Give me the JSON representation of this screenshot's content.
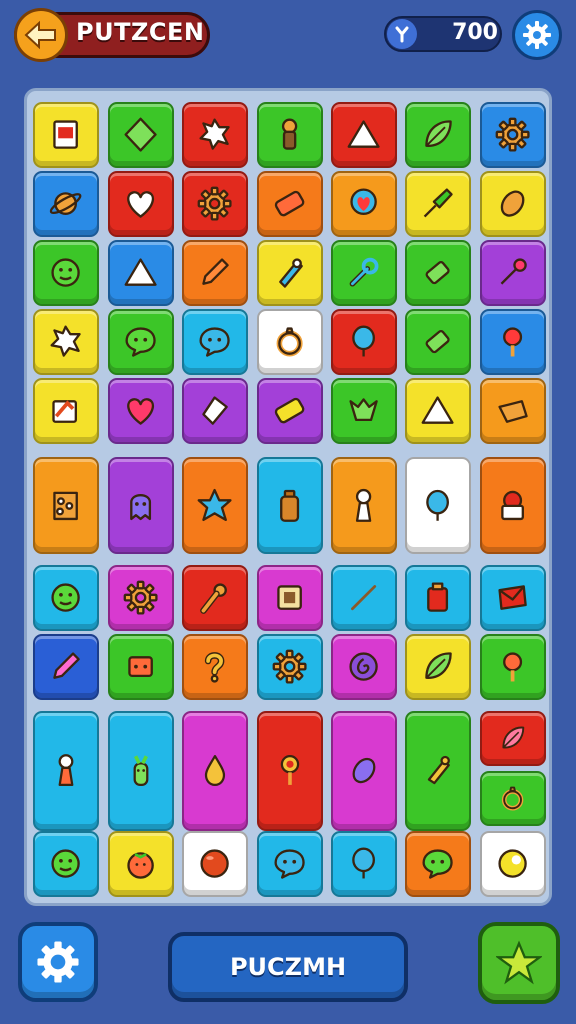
{
  "header": {
    "title": "PUTZCEN",
    "back_icon": "arrow-left-icon",
    "score": "700",
    "score_icon": "tool-icon",
    "settings_icon": "gear-icon"
  },
  "colors": {
    "background": "#3a5ba8",
    "board": "#b6cae4",
    "accent_orange": "#f5a11c",
    "title_pill": "#8f1f1f"
  },
  "board": {
    "rows": [
      [
        {
          "color": "#f4e12a",
          "icon": "card-icon"
        },
        {
          "color": "#3cc628",
          "icon": "diamond-icon"
        },
        {
          "color": "#e22a1e",
          "icon": "star-blob-icon"
        },
        {
          "color": "#3cc628",
          "icon": "pepper-mill-icon"
        },
        {
          "color": "#e22a1e",
          "icon": "triangle-icon"
        },
        {
          "color": "#3cc628",
          "icon": "leaf-icon"
        },
        {
          "color": "#2a8be6",
          "icon": "gear-icon"
        }
      ],
      [
        {
          "color": "#2a8be6",
          "icon": "planet-icon"
        },
        {
          "color": "#e22a1e",
          "icon": "heart-icon"
        },
        {
          "color": "#e22a1e",
          "icon": "gear-icon"
        },
        {
          "color": "#f57a1a",
          "icon": "tag-icon"
        },
        {
          "color": "#f59a1c",
          "icon": "heart-pin-icon"
        },
        {
          "color": "#f4e12a",
          "icon": "brush-icon"
        },
        {
          "color": "#f4e12a",
          "icon": "seed-icon"
        }
      ],
      [
        {
          "color": "#3cc628",
          "icon": "face-icon"
        },
        {
          "color": "#2a8be6",
          "icon": "triangle-icon"
        },
        {
          "color": "#f57a1a",
          "icon": "pencil-icon"
        },
        {
          "color": "#f4e12a",
          "icon": "tool-icon"
        },
        {
          "color": "#3cc628",
          "icon": "wrench-icon"
        },
        {
          "color": "#3cc628",
          "icon": "bar-icon"
        },
        {
          "color": "#a340d8",
          "icon": "wand-icon"
        }
      ],
      [
        {
          "color": "#f4e12a",
          "icon": "star-blob-icon"
        },
        {
          "color": "#3cc628",
          "icon": "bubble-icon"
        },
        {
          "color": "#22b8e8",
          "icon": "bubble-icon"
        },
        {
          "color": "#ffffff",
          "icon": "ring-icon"
        },
        {
          "color": "#e22a1e",
          "icon": "balloon-icon"
        },
        {
          "color": "#3cc628",
          "icon": "bar-icon"
        },
        {
          "color": "#2a8be6",
          "icon": "pin-icon"
        }
      ],
      [
        {
          "color": "#f4e12a",
          "icon": "box-icon"
        },
        {
          "color": "#a340d8",
          "icon": "heart-icon"
        },
        {
          "color": "#a340d8",
          "icon": "gem-icon"
        },
        {
          "color": "#a340d8",
          "icon": "tag-icon"
        },
        {
          "color": "#3cc628",
          "icon": "shield-icon"
        },
        {
          "color": "#f4e12a",
          "icon": "triangle-icon"
        },
        {
          "color": "#f59a1c",
          "icon": "bag-icon"
        }
      ],
      [
        {
          "color": "#f59a1c",
          "icon": "palette-icon"
        },
        {
          "color": "#a340d8",
          "icon": "ghost-icon"
        },
        {
          "color": "#f57a1a",
          "icon": "star-icon"
        },
        {
          "color": "#22b8e8",
          "icon": "bottle-icon"
        },
        {
          "color": "#f59a1c",
          "icon": "figure-icon"
        },
        {
          "color": "#ffffff",
          "icon": "balloon-icon"
        },
        {
          "color": "#f57a1a",
          "icon": "cup-icon"
        }
      ],
      [
        {
          "color": "#22b8e8",
          "icon": "face-icon"
        },
        {
          "color": "#d83ad0",
          "icon": "gear-icon"
        },
        {
          "color": "#e22a1e",
          "icon": "mic-icon"
        },
        {
          "color": "#d83ad0",
          "icon": "chip-icon"
        },
        {
          "color": "#22b8e8",
          "icon": "line-icon"
        },
        {
          "color": "#22b8e8",
          "icon": "jar-icon"
        },
        {
          "color": "#22b8e8",
          "icon": "envelope-icon"
        }
      ],
      [
        {
          "color": "#2a5fd6",
          "icon": "pencil-icon"
        },
        {
          "color": "#3cc628",
          "icon": "die-icon"
        },
        {
          "color": "#f57a1a",
          "icon": "question-icon"
        },
        {
          "color": "#22b8e8",
          "icon": "gear-icon"
        },
        {
          "color": "#d83ad0",
          "icon": "swirl-icon"
        },
        {
          "color": "#f4e12a",
          "icon": "leaf-icon"
        },
        {
          "color": "#3cc628",
          "icon": "pin-icon"
        }
      ],
      [
        {
          "color": "#22b8e8",
          "icon": "figure-icon",
          "tall": true
        },
        {
          "color": "#22b8e8",
          "icon": "cactus-icon",
          "tall": true
        },
        {
          "color": "#d83ad0",
          "icon": "drop-icon",
          "tall": true
        },
        {
          "color": "#e22a1e",
          "icon": "lollipop-icon",
          "tall": true
        },
        {
          "color": "#d83ad0",
          "icon": "seed-icon",
          "tall": true
        },
        {
          "color": "#3cc628",
          "icon": "fish-icon",
          "tall": true
        },
        {
          "color": "#e22a1e",
          "icon": "leaf-icon"
        },
        {
          "color": "#3cc628",
          "icon": "ring-icon"
        }
      ],
      [
        {
          "color": "#22b8e8",
          "icon": "face-icon"
        },
        {
          "color": "#f4e12a",
          "icon": "tomato-icon"
        },
        {
          "color": "#ffffff",
          "icon": "ball-icon"
        },
        {
          "color": "#22b8e8",
          "icon": "bubble-icon"
        },
        {
          "color": "#22b8e8",
          "icon": "balloon-icon"
        },
        {
          "color": "#f57a1a",
          "icon": "bubble-icon"
        },
        {
          "color": "#ffffff",
          "icon": "moon-icon"
        }
      ]
    ]
  },
  "footer": {
    "left_icon": "gear-icon",
    "main_label": "PUCZMH",
    "right_icon": "star-icon"
  }
}
